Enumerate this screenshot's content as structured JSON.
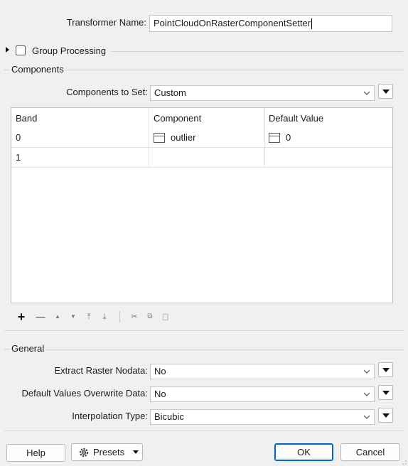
{
  "header": {
    "transformer_name_label": "Transformer Name:",
    "transformer_name_value": "PointCloudOnRasterComponentSetter"
  },
  "group_processing": {
    "label": "Group Processing",
    "checked": false
  },
  "components": {
    "section_title": "Components",
    "components_to_set_label": "Components to Set:",
    "components_to_set_value": "Custom",
    "table": {
      "columns": [
        "Band",
        "Component",
        "Default Value"
      ],
      "rows": [
        {
          "band": "0",
          "component": "outlier",
          "default_value": "0"
        },
        {
          "band": "1",
          "component": "",
          "default_value": ""
        }
      ]
    },
    "toolbar": {
      "add": "+",
      "remove": "—",
      "move_up": "▲",
      "move_down": "▼",
      "move_top": "⤒",
      "move_bottom": "⤓",
      "cut": "✂",
      "copy": "⧉",
      "paste": "📋"
    }
  },
  "general": {
    "section_title": "General",
    "extract_nodata_label": "Extract Raster Nodata:",
    "extract_nodata_value": "No",
    "overwrite_label": "Default Values Overwrite Data:",
    "overwrite_value": "No",
    "interpolation_label": "Interpolation Type:",
    "interpolation_value": "Bicubic"
  },
  "footer": {
    "help_label": "Help",
    "presets_label": "Presets",
    "ok_label": "OK",
    "cancel_label": "Cancel"
  },
  "colors": {
    "background": "#f0f0f0",
    "ok_border": "#0067c0"
  }
}
